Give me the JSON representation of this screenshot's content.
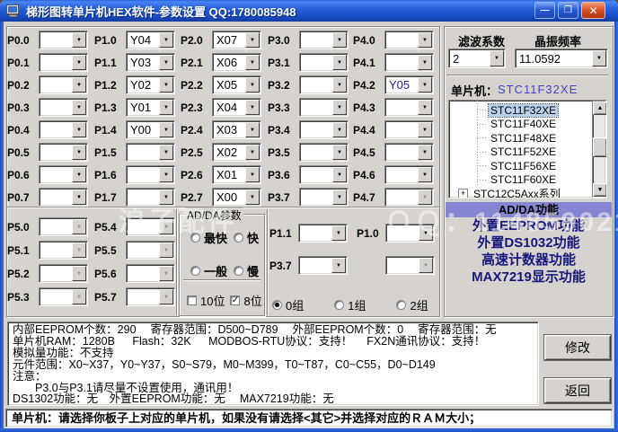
{
  "window": {
    "title": "梯形图转单片机HEX软件-参数设置 QQ:1780085948",
    "controls": [
      {
        "name": "minimize",
        "glyph": "—"
      },
      {
        "name": "maximize",
        "glyph": "❐"
      },
      {
        "name": "close",
        "glyph": "✕"
      }
    ]
  },
  "watermark": "浪子配件　　　　　ＱＱ：11485902152",
  "icons": {
    "chevron_down": "▼",
    "scroll_up": "▲",
    "scroll_down": "▼",
    "expand_plus": "+"
  },
  "ports": {
    "p0": [
      {
        "label": "P0.0",
        "value": ""
      },
      {
        "label": "P0.1",
        "value": ""
      },
      {
        "label": "P0.2",
        "value": ""
      },
      {
        "label": "P0.3",
        "value": ""
      },
      {
        "label": "P0.4",
        "value": ""
      },
      {
        "label": "P0.5",
        "value": ""
      },
      {
        "label": "P0.6",
        "value": ""
      },
      {
        "label": "P0.7",
        "value": ""
      }
    ],
    "p1": [
      {
        "label": "P1.0",
        "value": "Y04"
      },
      {
        "label": "P1.1",
        "value": "Y03"
      },
      {
        "label": "P1.2",
        "value": "Y02"
      },
      {
        "label": "P1.3",
        "value": "Y01"
      },
      {
        "label": "P1.4",
        "value": "Y00"
      },
      {
        "label": "P1.5",
        "value": ""
      },
      {
        "label": "P1.6",
        "value": ""
      },
      {
        "label": "P1.7",
        "value": ""
      }
    ],
    "p2": [
      {
        "label": "P2.0",
        "value": "X07"
      },
      {
        "label": "P2.1",
        "value": "X06"
      },
      {
        "label": "P2.2",
        "value": "X05"
      },
      {
        "label": "P2.3",
        "value": "X04"
      },
      {
        "label": "P2.4",
        "value": "X03"
      },
      {
        "label": "P2.5",
        "value": "X02"
      },
      {
        "label": "P2.6",
        "value": "X01"
      },
      {
        "label": "P2.7",
        "value": "X00"
      }
    ],
    "p3": [
      {
        "label": "P3.0",
        "value": ""
      },
      {
        "label": "P3.1",
        "value": ""
      },
      {
        "label": "P3.2",
        "value": ""
      },
      {
        "label": "P3.3",
        "value": ""
      },
      {
        "label": "P3.4",
        "value": ""
      },
      {
        "label": "P3.5",
        "value": ""
      },
      {
        "label": "P3.6",
        "value": ""
      },
      {
        "label": "P3.7",
        "value": ""
      }
    ],
    "p4": [
      {
        "label": "P4.0",
        "value": ""
      },
      {
        "label": "P4.1",
        "value": ""
      },
      {
        "label": "P4.2",
        "value": "Y05",
        "navy": true
      },
      {
        "label": "P4.3",
        "value": ""
      },
      {
        "label": "P4.4",
        "value": ""
      },
      {
        "label": "P4.5",
        "value": ""
      },
      {
        "label": "P4.6",
        "value": ""
      },
      {
        "label": "P4.7",
        "value": "",
        "disabled": true
      }
    ],
    "p5a": [
      {
        "label": "P5.0",
        "value": "",
        "disabled": true
      },
      {
        "label": "P5.1",
        "value": "",
        "disabled": true
      },
      {
        "label": "P5.2",
        "value": "",
        "disabled": true
      },
      {
        "label": "P5.3",
        "value": "",
        "disabled": true
      }
    ],
    "p5b": [
      {
        "label": "P5.4",
        "value": "",
        "disabled": true
      },
      {
        "label": "P5.5",
        "value": "",
        "disabled": true
      },
      {
        "label": "P5.6",
        "value": "",
        "disabled": true
      },
      {
        "label": "P5.7",
        "value": "",
        "disabled": true
      }
    ]
  },
  "adda": {
    "group_label": "AD/DA参数",
    "speed_radios": [
      {
        "label": "最快",
        "checked": false
      },
      {
        "label": "快",
        "checked": false
      },
      {
        "label": "一般",
        "checked": false
      },
      {
        "label": "慢",
        "checked": false
      }
    ],
    "bit_checkboxes": [
      {
        "label": "10位",
        "checked": false
      },
      {
        "label": "8位",
        "checked": true
      }
    ]
  },
  "comm": {
    "rows": [
      {
        "label": "P1.1",
        "value": "",
        "disabled": false
      },
      {
        "label": "P1.0",
        "value": "",
        "disabled": false
      },
      {
        "label": "P3.7",
        "value": "",
        "disabled": false
      },
      {
        "label": "",
        "value": "",
        "disabled": true
      }
    ],
    "group_radios": [
      {
        "label": "0组",
        "checked": true
      },
      {
        "label": "1组",
        "checked": false
      },
      {
        "label": "2组",
        "checked": false
      }
    ]
  },
  "settings": {
    "filter_label": "滤波系数",
    "filter_value": "2",
    "crystal_label": "晶振频率",
    "crystal_value": "11.0592",
    "mcu_label": "单片机：",
    "mcu_value": "STC11F32XE"
  },
  "mcu_tree": {
    "items": [
      {
        "label": "STC11F32XE",
        "selected": true
      },
      {
        "label": "STC11F40XE"
      },
      {
        "label": "STC11F48XE"
      },
      {
        "label": "STC11F52XE"
      },
      {
        "label": "STC11F56XE"
      },
      {
        "label": "STC11F60XE"
      },
      {
        "label": "STC12C5Axx系列",
        "expandable": true
      }
    ]
  },
  "functions": {
    "items": [
      {
        "label": "AD/DA功能",
        "selected": true
      },
      {
        "label": "外置EEPROM功能"
      },
      {
        "label": "外置DS1032功能"
      },
      {
        "label": "高速计数器功能"
      },
      {
        "label": "MAX7219显示功能"
      }
    ]
  },
  "info_panel": {
    "lines": [
      "内部EEPROM个数：290　 寄存器范围：D500~D789 　外部EEPROM个数：0 　寄存器范围：无",
      "单片机RAM：1280B 　 Flash：32K 　 MODBOS-RTU协议：支持！　 FX2N通讯协议：支持！",
      "模拟量功能：不支持",
      "元件范围：X0~X37，Y0~Y37，S0~S79，M0~M399，T0~T87，C0~C55，D0~D149",
      "注意：",
      "　　P3.0与P3.1请尽量不设置使用，通讯用！",
      "DS1302功能：无　外置EEPROM功能：无　 MAX7219功能：无"
    ]
  },
  "buttons": {
    "modify": "修改",
    "back": "返回"
  },
  "status_bar": "单片机：请选择你板子上对应的单片机，如果没有请选择<其它>并选择对应的ＲＡＭ大小；"
}
